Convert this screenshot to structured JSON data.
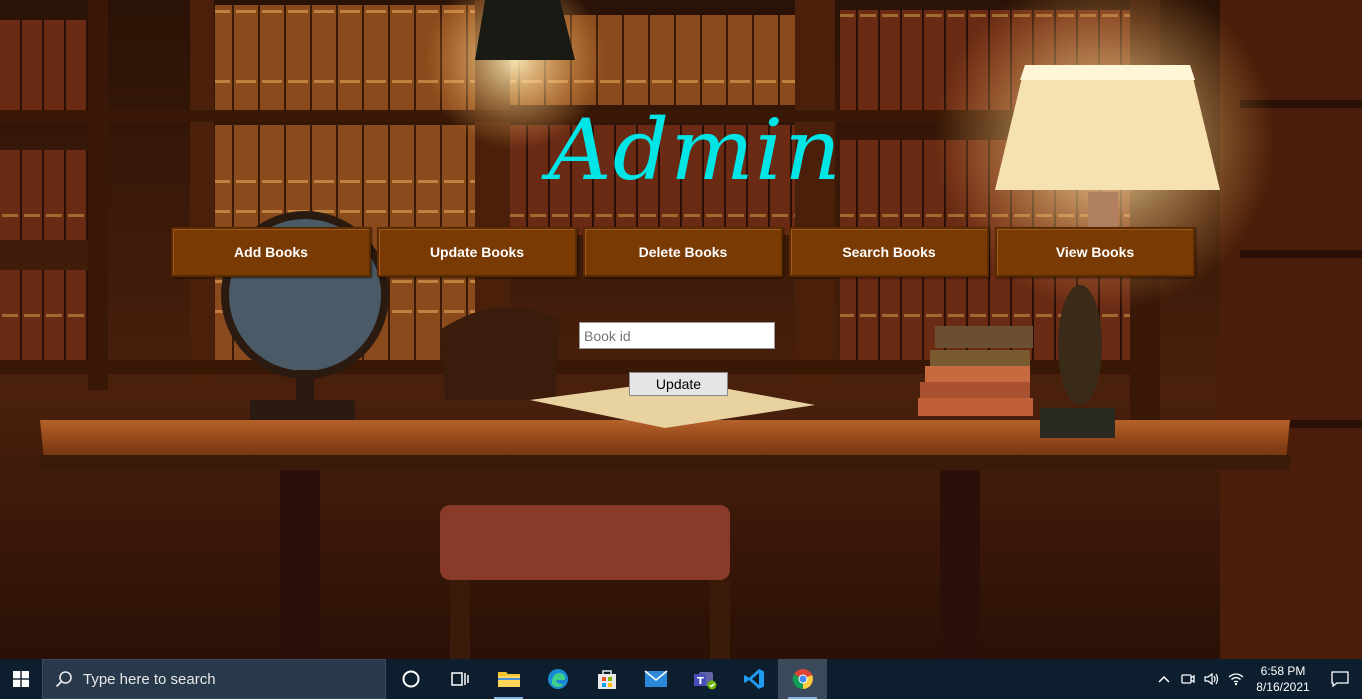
{
  "app": {
    "title": "Admin"
  },
  "nav": {
    "items": [
      {
        "label": "Add Books"
      },
      {
        "label": "Update Books"
      },
      {
        "label": "Delete Books"
      },
      {
        "label": "Search Books"
      },
      {
        "label": "View Books"
      }
    ]
  },
  "form": {
    "book_id_placeholder": "Book id",
    "book_id_value": "",
    "update_label": "Update"
  },
  "taskbar": {
    "search_placeholder": "Type here to search",
    "time": "6:58 PM",
    "date": "8/16/2021",
    "apps": [
      "task-view",
      "file-explorer",
      "edge",
      "store",
      "mail",
      "teams",
      "vscode",
      "chrome"
    ],
    "active_app": "chrome"
  },
  "colors": {
    "title": "#00e5e5",
    "nav_button_bg": "#7a3a04",
    "taskbar_bg": "#0d1f2f"
  }
}
